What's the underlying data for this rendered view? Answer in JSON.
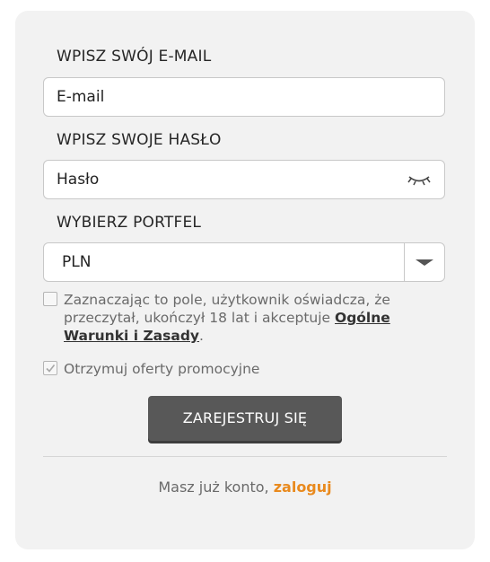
{
  "form": {
    "email_label": "WPISZ SWÓJ E-MAIL",
    "email_placeholder": "E-mail",
    "password_label": "WPISZ SWOJE HASŁO",
    "password_placeholder": "Hasło",
    "password_toggle_icon": "eye-closed-icon",
    "wallet_label": "WYBIERZ PORTFEL",
    "wallet_selected": "PLN",
    "wallet_dropdown_icon": "chevron-down-icon"
  },
  "terms": {
    "checked": false,
    "text": "Zaznaczając to pole, użytkownik oświadcza, że przeczytał, ukończył 18 lat i akceptuje ",
    "link_text": "Ogólne Warunki i Zasady",
    "suffix": "."
  },
  "promo": {
    "checked": true,
    "text": "Otrzymuj oferty promocyjne"
  },
  "register_button": "ZAREJESTRUJ SIĘ",
  "login": {
    "prompt": "Masz już konto, ",
    "link": "zaloguj"
  },
  "colors": {
    "card_background": "#f2f2f2",
    "button_background": "#585858",
    "login_link": "#e98a1e"
  }
}
